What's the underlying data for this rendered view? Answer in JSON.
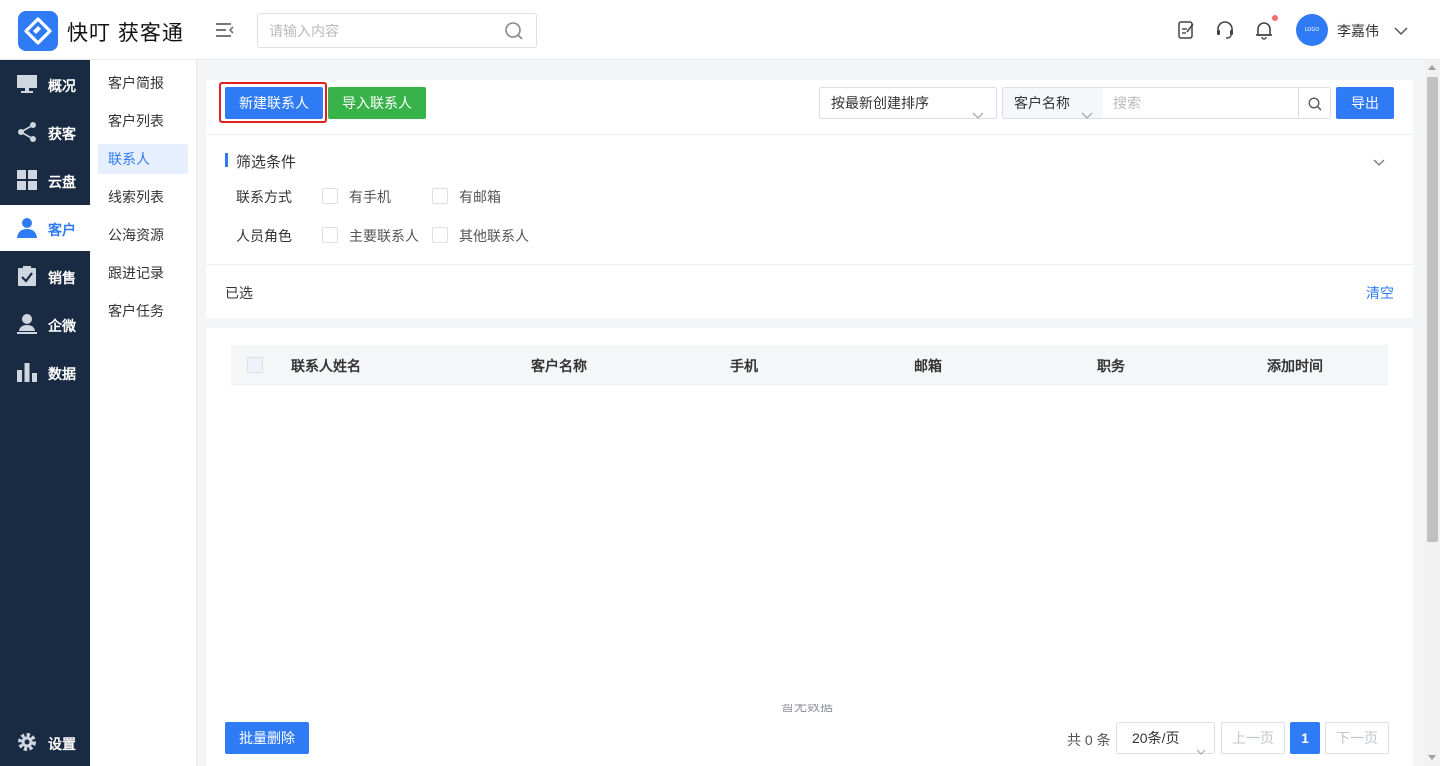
{
  "header": {
    "brand": "快叮 获客通",
    "search_placeholder": "请输入内容",
    "username": "李嘉伟",
    "avatar_text": "LOGO",
    "icons": [
      "edit-note-icon",
      "headset-icon",
      "bell-icon"
    ],
    "notification_dot_color": "#f56c6c"
  },
  "sidebar": {
    "items": [
      {
        "label": "概况",
        "icon": "monitor-icon"
      },
      {
        "label": "获客",
        "icon": "share-icon"
      },
      {
        "label": "云盘",
        "icon": "grid-icon"
      },
      {
        "label": "客户",
        "icon": "user-icon",
        "active": true
      },
      {
        "label": "销售",
        "icon": "clipboard-check-icon"
      },
      {
        "label": "企微",
        "icon": "person-icon"
      },
      {
        "label": "数据",
        "icon": "bar-chart-icon"
      }
    ],
    "settings_label": "设置"
  },
  "submenu": {
    "items": [
      "客户简报",
      "客户列表",
      "联系人",
      "线索列表",
      "公海资源",
      "跟进记录",
      "客户任务"
    ],
    "active_index": 2
  },
  "toolbar": {
    "new_contact": "新建联系人",
    "import_contact": "导入联系人",
    "sort_value": "按最新创建排序",
    "field_value": "客户名称",
    "keyword_placeholder": "搜索",
    "export": "导出"
  },
  "filters": {
    "title": "筛选条件",
    "groups": [
      {
        "label": "联系方式",
        "options": [
          "有手机",
          "有邮箱"
        ]
      },
      {
        "label": "人员角色",
        "options": [
          "主要联系人",
          "其他联系人"
        ]
      }
    ],
    "selected_label": "已选",
    "clear": "清空"
  },
  "table": {
    "columns": [
      "联系人姓名",
      "客户名称",
      "手机",
      "邮箱",
      "职务",
      "添加时间"
    ],
    "rows": [],
    "empty_text": "暂无数据"
  },
  "footer": {
    "batch_delete": "批量删除",
    "total": "共 0 条",
    "page_size": "20条/页",
    "prev": "上一页",
    "current_page": "1",
    "next": "下一页"
  },
  "colors": {
    "primary": "#2f7bf5",
    "success": "#38b34a",
    "sidebar_bg": "#192a43",
    "highlight_outline": "#e02020"
  }
}
